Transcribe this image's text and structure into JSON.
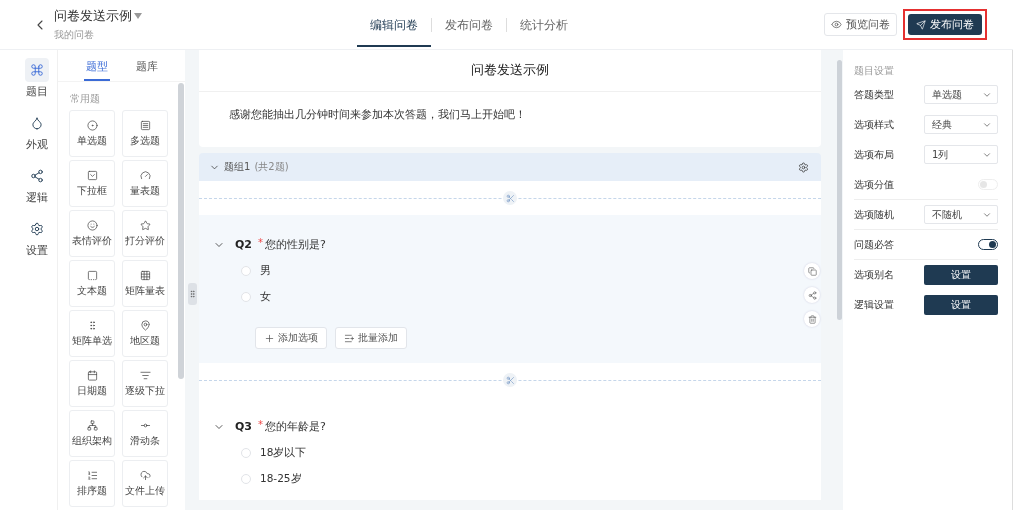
{
  "header": {
    "title": "问卷发送示例",
    "subtitle": "我的问卷",
    "tabs": [
      {
        "label": "编辑问卷",
        "selected": true
      },
      {
        "label": "发布问卷",
        "selected": false
      },
      {
        "label": "统计分析",
        "selected": false
      }
    ],
    "preview_button": "预览问卷",
    "publish_button": {
      "label": "发布问卷",
      "highlighted": true
    }
  },
  "nav": [
    {
      "label": "题目",
      "selected": true
    },
    {
      "label": "外观",
      "selected": false
    },
    {
      "label": "逻辑",
      "selected": false
    },
    {
      "label": "设置",
      "selected": false
    }
  ],
  "library": {
    "tabs": [
      {
        "label": "题型",
        "selected": true
      },
      {
        "label": "题库",
        "selected": false
      }
    ],
    "section_label": "常用题",
    "items": [
      {
        "label": "单选题"
      },
      {
        "label": "多选题"
      },
      {
        "label": "下拉框"
      },
      {
        "label": "量表题"
      },
      {
        "label": "表情评价"
      },
      {
        "label": "打分评价"
      },
      {
        "label": "文本题"
      },
      {
        "label": "矩阵量表"
      },
      {
        "label": "矩阵单选"
      },
      {
        "label": "地区题"
      },
      {
        "label": "日期题"
      },
      {
        "label": "逐级下拉"
      },
      {
        "label": "组织架构"
      },
      {
        "label": "滑动条"
      },
      {
        "label": "排序题"
      },
      {
        "label": "文件上传"
      }
    ]
  },
  "survey": {
    "title": "问卷发送示例",
    "intro": "感谢您能抽出几分钟时间来参加本次答题，我们马上开始吧！",
    "group": {
      "label": "题组1",
      "count": "(共2题)",
      "expanded": true
    },
    "questions": [
      {
        "number": "Q2",
        "required_mark": "*",
        "text": "您的性别是?",
        "selected": true,
        "options": [
          "男",
          "女"
        ],
        "actions": [
          "添加选项",
          "批量添加"
        ]
      },
      {
        "number": "Q3",
        "required_mark": "*",
        "text": "您的年龄是?",
        "selected": false,
        "options": [
          "18岁以下",
          "18-25岁"
        ]
      }
    ]
  },
  "settings": {
    "heading": "题目设置",
    "rows": [
      {
        "kind": "select",
        "label": "答题类型",
        "value": "单选题"
      },
      {
        "kind": "select",
        "label": "选项样式",
        "value": "经典"
      },
      {
        "kind": "select",
        "label": "选项布局",
        "value": "1列"
      },
      {
        "kind": "toggle",
        "label": "选项分值",
        "on": false
      },
      {
        "kind": "select",
        "label": "选项随机",
        "value": "不随机"
      },
      {
        "kind": "toggle",
        "label": "问题必答",
        "on": true
      },
      {
        "kind": "button",
        "label": "选项别名",
        "value": "设置"
      },
      {
        "kind": "button",
        "label": "逻辑设置",
        "value": "设置"
      }
    ]
  }
}
